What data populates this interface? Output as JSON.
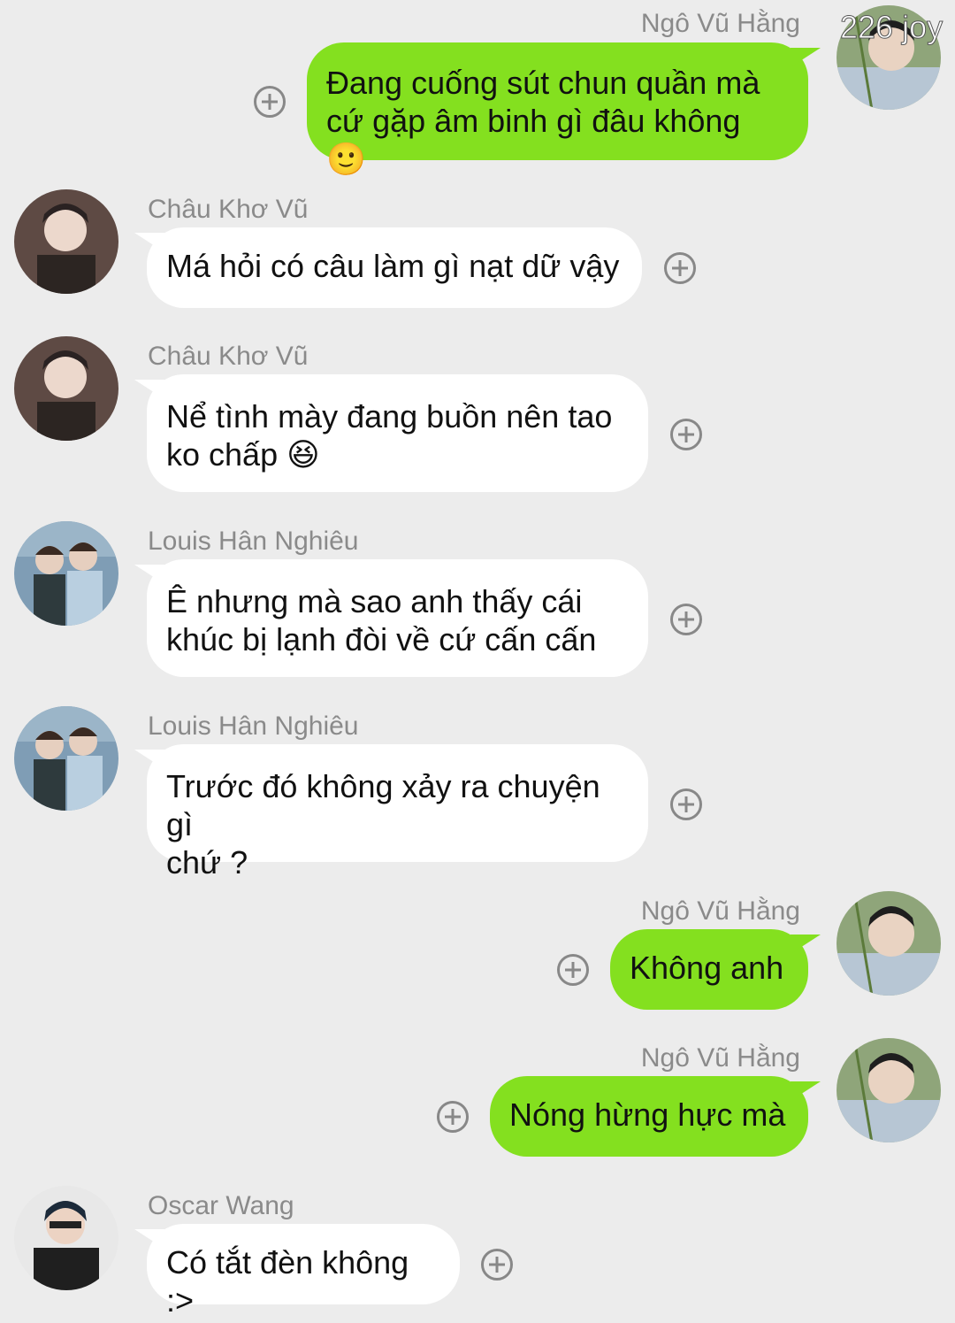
{
  "overlay_badge": "226 joy",
  "messages": [
    {
      "sender": "Ngô Vũ Hằng",
      "direction": "out",
      "lines": [
        "Đang cuống sút chun quần mà",
        "cứ gặp âm binh gì đâu không 🙂"
      ]
    },
    {
      "sender": "Châu Khơ Vũ",
      "direction": "in",
      "lines": [
        "Má hỏi có câu làm gì nạt dữ vậy"
      ]
    },
    {
      "sender": "Châu Khơ Vũ",
      "direction": "in",
      "lines": [
        "Nể tình mày đang buồn nên tao",
        "ko chấp 😆"
      ]
    },
    {
      "sender": "Louis Hân Nghiêu",
      "direction": "in",
      "lines": [
        "Ê nhưng mà sao anh thấy cái",
        "khúc bị lạnh đòi về cứ cấn cấn"
      ]
    },
    {
      "sender": "Louis Hân Nghiêu",
      "direction": "in",
      "lines": [
        "Trước đó không xảy ra chuyện gì",
        "chứ ?"
      ]
    },
    {
      "sender": "Ngô Vũ Hằng",
      "direction": "out",
      "lines": [
        "Không anh"
      ]
    },
    {
      "sender": "Ngô Vũ Hằng",
      "direction": "out",
      "lines": [
        "Nóng hừng hực mà"
      ]
    },
    {
      "sender": "Oscar Wang",
      "direction": "in",
      "lines": [
        "Có tắt đèn không :>"
      ]
    }
  ],
  "icons": {
    "add_reaction": "plus-circle-icon",
    "avatar": "profile-photo"
  },
  "colors": {
    "background": "#ececec",
    "outgoing_bubble": "#84e01f",
    "incoming_bubble": "#ffffff",
    "name_text": "#8a8a8a"
  }
}
